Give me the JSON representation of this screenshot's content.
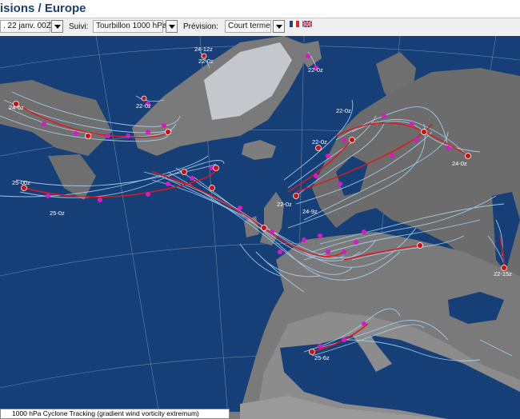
{
  "header": {
    "title": "isions / Europe"
  },
  "toolbar": {
    "date_value": ". 22 janv. 00Z",
    "suivi_label": "Suivi:",
    "suivi_value": "Tourbillon 1000 hPa",
    "prevision_label": "Prévision:",
    "prevision_value": "Court terme",
    "lang_fr": "fr",
    "lang_en": "en"
  },
  "map": {
    "caption": "1000 hPa Cyclone Tracking (gradient wind vorticity extremum)",
    "colors": {
      "sea": "#173f77",
      "land": "#6f6f6f",
      "ice": "#c4c8cc",
      "track": "#a7d3f2",
      "main_track": "#e01818",
      "forecast_point": "#d81ac6",
      "analysis_point": "#d01010"
    },
    "track_labels": [
      "24-12z",
      "22-0z",
      "22-0z",
      "24-6z",
      "22-0z",
      "22-0z",
      "22-0z",
      "24-0z",
      "25-00z",
      "25-0z",
      "22-0z",
      "24-9z",
      "22-15z",
      "25-6z"
    ]
  }
}
